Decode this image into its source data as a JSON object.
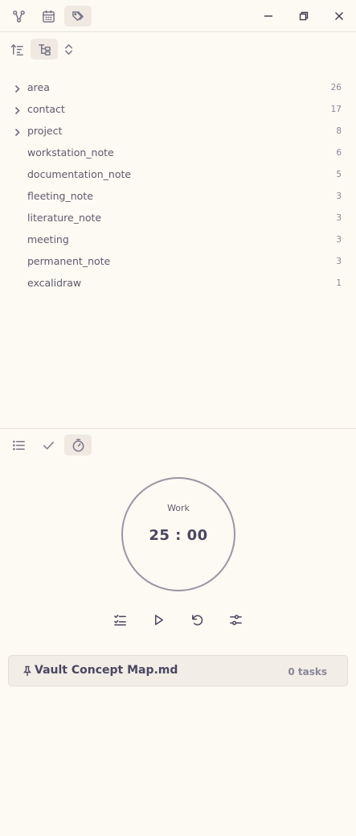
{
  "topbar": {
    "icons": [
      "graph-icon",
      "calendar-icon",
      "tags-icon"
    ],
    "window": [
      "minimize-icon",
      "restore-icon",
      "close-icon"
    ]
  },
  "tag_toolbar": {
    "icons": [
      "sort-icon",
      "tree-view-icon",
      "expand-collapse-icon"
    ]
  },
  "tags": [
    {
      "name": "area",
      "count": "26",
      "expandable": true
    },
    {
      "name": "contact",
      "count": "17",
      "expandable": true
    },
    {
      "name": "project",
      "count": "8",
      "expandable": true
    },
    {
      "name": "workstation_note",
      "count": "6",
      "expandable": false
    },
    {
      "name": "documentation_note",
      "count": "5",
      "expandable": false
    },
    {
      "name": "fleeting_note",
      "count": "3",
      "expandable": false
    },
    {
      "name": "literature_note",
      "count": "3",
      "expandable": false
    },
    {
      "name": "meeting",
      "count": "3",
      "expandable": false
    },
    {
      "name": "permanent_note",
      "count": "3",
      "expandable": false
    },
    {
      "name": "excalidraw",
      "count": "1",
      "expandable": false
    }
  ],
  "bottom_toolbar": {
    "icons": [
      "list-icon",
      "check-icon",
      "timer-icon"
    ]
  },
  "timer": {
    "mode": "Work",
    "time": "25 : 00"
  },
  "controls": [
    "task-list-icon",
    "play-icon",
    "reset-icon",
    "settings-sliders-icon"
  ],
  "task_card": {
    "file": "Vault Concept Map.md",
    "tasks": "0 tasks"
  },
  "colors": {
    "background": "#fdf9f3",
    "active_button": "#efe9e2",
    "text": "#5e5b6c",
    "accent": "#4a4760"
  }
}
